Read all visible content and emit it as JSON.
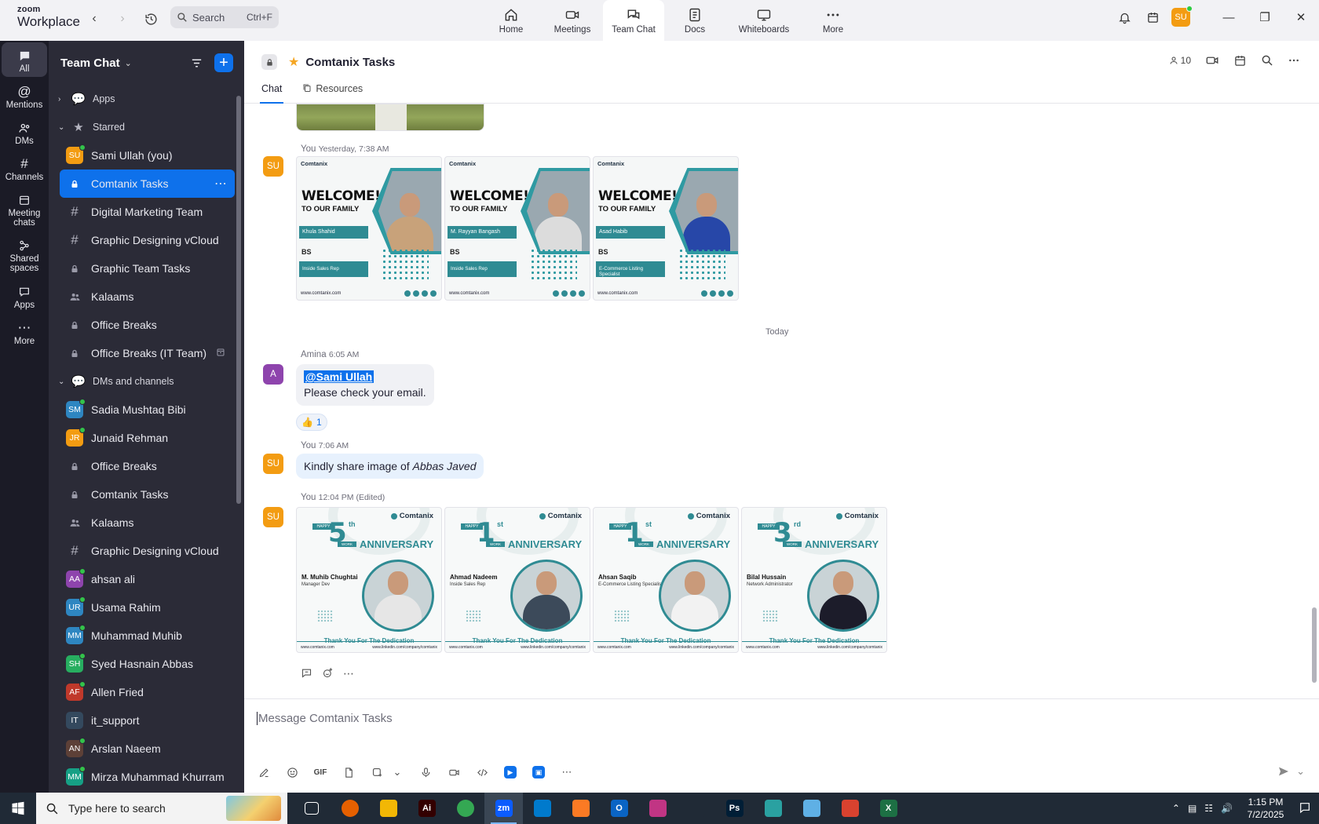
{
  "app": {
    "logo_top": "zoom",
    "logo_bottom": "Workplace",
    "search_label": "Search",
    "search_shortcut": "Ctrl+F",
    "user_initials": "SU",
    "tabs": [
      {
        "label": "Home",
        "icon": "home-icon"
      },
      {
        "label": "Meetings",
        "icon": "video-icon"
      },
      {
        "label": "Team Chat",
        "icon": "chat-icon",
        "active": true
      },
      {
        "label": "Docs",
        "icon": "doc-icon"
      },
      {
        "label": "Whiteboards",
        "icon": "whiteboard-icon"
      },
      {
        "label": "More",
        "icon": "more-icon"
      }
    ],
    "window": {
      "minimize": "—",
      "maximize": "❐",
      "close": "✕"
    }
  },
  "rail": {
    "items": [
      {
        "label": "All",
        "icon": "chat-bubble-icon",
        "active": true
      },
      {
        "label": "Mentions",
        "icon": "at-icon"
      },
      {
        "label": "DMs",
        "icon": "people-icon"
      },
      {
        "label": "Channels",
        "icon": "hash-icon"
      },
      {
        "label": "Meeting chats",
        "icon": "calendar-icon"
      },
      {
        "label": "Shared spaces",
        "icon": "share-icon"
      },
      {
        "label": "Apps",
        "icon": "apps-icon"
      },
      {
        "label": "More",
        "icon": "ellipsis-icon"
      }
    ]
  },
  "sidebar": {
    "title": "Team Chat",
    "apps_label": "Apps",
    "starred_label": "Starred",
    "dms_label": "DMs and channels",
    "starred": [
      {
        "label": "Sami Ullah (you)",
        "kind": "avatar",
        "initials": "SU",
        "color": "#f39c12",
        "online": true
      },
      {
        "label": "Comtanix Tasks",
        "kind": "lock",
        "selected": true
      },
      {
        "label": "Digital Marketing Team",
        "kind": "hash"
      },
      {
        "label": "Graphic Designing vCloud",
        "kind": "hash"
      },
      {
        "label": "Graphic Team Tasks",
        "kind": "lock"
      },
      {
        "label": "Kalaams",
        "kind": "group"
      },
      {
        "label": "Office Breaks",
        "kind": "lock"
      },
      {
        "label": "Office Breaks (IT Team)",
        "kind": "lock",
        "extra": true
      }
    ],
    "dms": [
      {
        "label": "Sadia Mushtaq Bibi",
        "kind": "avatar",
        "initials": "SM",
        "color": "#2e86c1",
        "online": true
      },
      {
        "label": "Junaid Rehman",
        "kind": "avatar",
        "initials": "JR",
        "color": "#f39c12",
        "online": true
      },
      {
        "label": "Office Breaks",
        "kind": "lock"
      },
      {
        "label": "Comtanix Tasks",
        "kind": "lock"
      },
      {
        "label": "Kalaams",
        "kind": "group"
      },
      {
        "label": "Graphic Designing vCloud",
        "kind": "hash"
      },
      {
        "label": "ahsan ali",
        "kind": "avatar",
        "initials": "AA",
        "color": "#8e44ad",
        "online": true
      },
      {
        "label": "Usama Rahim",
        "kind": "avatar",
        "initials": "UR",
        "color": "#2e86c1",
        "online": true
      },
      {
        "label": "Muhammad Muhib",
        "kind": "avatar",
        "initials": "MM",
        "color": "#2e86c1",
        "online": true
      },
      {
        "label": "Syed Hasnain Abbas",
        "kind": "avatar",
        "initials": "SH",
        "color": "#27ae60",
        "online": true
      },
      {
        "label": "Allen Fried",
        "kind": "avatar",
        "initials": "AF",
        "color": "#c0392b",
        "online": true
      },
      {
        "label": "it_support",
        "kind": "avatar",
        "initials": "IT",
        "color": "#34495e",
        "online": false
      },
      {
        "label": "Arslan Naeem",
        "kind": "avatar",
        "initials": "AN",
        "color": "#5d4037",
        "online": true
      },
      {
        "label": "Mirza Muhammad Khurram",
        "kind": "avatar",
        "initials": "MM",
        "color": "#16a085",
        "online": true
      }
    ]
  },
  "channel": {
    "name": "Comtanix Tasks",
    "member_count": "10",
    "tab_chat": "Chat",
    "tab_resources": "Resources"
  },
  "messages": {
    "m1": {
      "sender": "You",
      "time": "Yesterday, 7:38 AM",
      "initials": "SU"
    },
    "welcome_cards": [
      {
        "brand": "Comtanix",
        "welcome": "WELCOME!",
        "sub": "TO OUR FAMILY",
        "name": "Khula Shahid",
        "bs": "BS",
        "role": "Inside Sales Rep",
        "url": "www.comtanix.com",
        "shirt": "#c8a27a"
      },
      {
        "brand": "Comtanix",
        "welcome": "WELCOME!",
        "sub": "TO OUR FAMILY",
        "name": "M. Rayyan Bangash",
        "bs": "BS",
        "role": "Inside Sales Rep",
        "url": "www.comtanix.com",
        "shirt": "#dcdcdc"
      },
      {
        "brand": "Comtanix",
        "welcome": "WELCOME!",
        "sub": "TO OUR FAMILY",
        "name": "Asad Habib",
        "bs": "BS",
        "role": "E-Commerce Listing Specialist",
        "url": "www.comtanix.com",
        "shirt": "#2747a8"
      }
    ],
    "day_divider": "Today",
    "m2": {
      "sender": "Amina",
      "time": "6:05 AM",
      "initial": "A",
      "mention": "@Sami Ullah",
      "text": "Please check your email.",
      "reaction_emoji": "👍",
      "reaction_count": "1"
    },
    "m3": {
      "sender": "You",
      "time": "7:06 AM",
      "initials": "SU",
      "text_pre": "Kindly share image of ",
      "text_em": "Abbas Javed"
    },
    "m4": {
      "sender": "You",
      "time": "12:04 PM (Edited)",
      "initials": "SU"
    },
    "anniversary_cards": [
      {
        "brand": "Comtanix",
        "happy": "HAPPY",
        "num": "5",
        "sup": "th",
        "work": "WORK",
        "title": "ANNIVERSARY",
        "name": "M. Muhib Chughtai",
        "role": "Manager Dev",
        "thanks": "Thank You For The Dedication",
        "url": "www.comtanix.com",
        "url2": "www.linkedin.com/company/comtanix",
        "shirt": "#e6e6e6"
      },
      {
        "brand": "Comtanix",
        "happy": "HAPPY",
        "num": "1",
        "sup": "st",
        "work": "WORK",
        "title": "ANNIVERSARY",
        "name": "Ahmad Nadeem",
        "role": "Inside Sales Rep",
        "thanks": "Thank You For The Dedication",
        "url": "www.comtanix.com",
        "url2": "www.linkedin.com/company/comtanix",
        "shirt": "#3c4a5a"
      },
      {
        "brand": "Comtanix",
        "happy": "HAPPY",
        "num": "1",
        "sup": "st",
        "work": "WORK",
        "title": "ANNIVERSARY",
        "name": "Ahsan Saqib",
        "role": "E-Commerce Listing Specialist",
        "thanks": "Thank You For The Dedication",
        "url": "www.comtanix.com",
        "url2": "www.linkedin.com/company/comtanix",
        "shirt": "#f2f2f2"
      },
      {
        "brand": "Comtanix",
        "happy": "HAPPY",
        "num": "3",
        "sup": "rd",
        "work": "WORK",
        "title": "ANNIVERSARY",
        "name": "Bilal Hussain",
        "role": "Network Administrator",
        "thanks": "Thank You For The Dedication",
        "url": "www.comtanix.com",
        "url2": "www.linkedin.com/company/comtanix",
        "shirt": "#1c1c2a"
      }
    ]
  },
  "composer": {
    "placeholder": "Message Comtanix Tasks",
    "gif_label": "GIF"
  },
  "taskbar": {
    "search_placeholder": "Type here to search",
    "time": "1:15 PM",
    "date": "7/2/2025",
    "apps": [
      {
        "name": "task-view",
        "label": "",
        "color": "#202a36"
      },
      {
        "name": "firefox",
        "label": "",
        "color": "#e66000"
      },
      {
        "name": "file-explorer",
        "label": "",
        "color": "#f2b705"
      },
      {
        "name": "illustrator",
        "label": "Ai",
        "color": "#330000"
      },
      {
        "name": "chrome",
        "label": "",
        "color": "#34a853"
      },
      {
        "name": "zoom",
        "label": "zm",
        "color": "#0b5cff",
        "active": true
      },
      {
        "name": "vscode",
        "label": "",
        "color": "#007acc"
      },
      {
        "name": "xampp",
        "label": "",
        "color": "#fb7a24"
      },
      {
        "name": "outlook",
        "label": "O",
        "color": "#0a64c4"
      },
      {
        "name": "photos",
        "label": "",
        "color": "#c13584"
      },
      {
        "name": "pen-tool",
        "label": "",
        "color": "#202a36"
      },
      {
        "name": "photoshop",
        "label": "Ps",
        "color": "#001e36"
      },
      {
        "name": "app-teal",
        "label": "",
        "color": "#2aa1a1"
      },
      {
        "name": "app-blue",
        "label": "",
        "color": "#5fb0e5"
      },
      {
        "name": "app-red",
        "label": "",
        "color": "#d9422f"
      },
      {
        "name": "excel",
        "label": "X",
        "color": "#1d7044"
      }
    ]
  }
}
